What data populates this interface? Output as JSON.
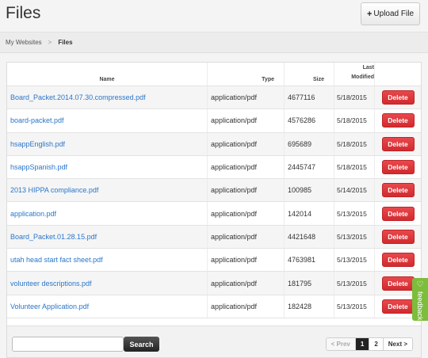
{
  "header": {
    "title": "Files",
    "upload_label": "Upload File",
    "upload_icon": "plus-icon"
  },
  "breadcrumb": {
    "parent": "My Websites",
    "separator": ">",
    "current": "Files"
  },
  "table": {
    "columns": {
      "name": "Name",
      "type": "Type",
      "size": "Size",
      "modified_1": "Last",
      "modified_2": "Modified"
    },
    "delete_label": "Delete",
    "rows": [
      {
        "name": "Board_Packet.2014.07.30.compressed.pdf",
        "type": "application/pdf",
        "size": "4677116",
        "modified": "5/18/2015"
      },
      {
        "name": "board-packet.pdf",
        "type": "application/pdf",
        "size": "4576286",
        "modified": "5/18/2015"
      },
      {
        "name": "hsappEnglish.pdf",
        "type": "application/pdf",
        "size": "695689",
        "modified": "5/18/2015"
      },
      {
        "name": "hsappSpanish.pdf",
        "type": "application/pdf",
        "size": "2445747",
        "modified": "5/18/2015"
      },
      {
        "name": "2013 HIPPA compliance.pdf",
        "type": "application/pdf",
        "size": "100985",
        "modified": "5/14/2015"
      },
      {
        "name": "application.pdf",
        "type": "application/pdf",
        "size": "142014",
        "modified": "5/13/2015"
      },
      {
        "name": "Board_Packet.01.28.15.pdf",
        "type": "application/pdf",
        "size": "4421648",
        "modified": "5/13/2015"
      },
      {
        "name": "utah head start fact sheet.pdf",
        "type": "application/pdf",
        "size": "4763981",
        "modified": "5/13/2015"
      },
      {
        "name": "volunteer descriptions.pdf",
        "type": "application/pdf",
        "size": "181795",
        "modified": "5/13/2015"
      },
      {
        "name": "Volunteer Application.pdf",
        "type": "application/pdf",
        "size": "182428",
        "modified": "5/13/2015"
      }
    ]
  },
  "footer": {
    "search_value": "",
    "search_label": "Search",
    "pager": {
      "prev": "< Prev",
      "pages": [
        "1",
        "2"
      ],
      "current_page": "1",
      "next": "Next >"
    }
  },
  "feedback": {
    "label": "feedback",
    "icon": "megaphone-icon"
  },
  "colors": {
    "link": "#2b76c9",
    "delete": "#d9363a",
    "feedback": "#7cbd3c"
  }
}
